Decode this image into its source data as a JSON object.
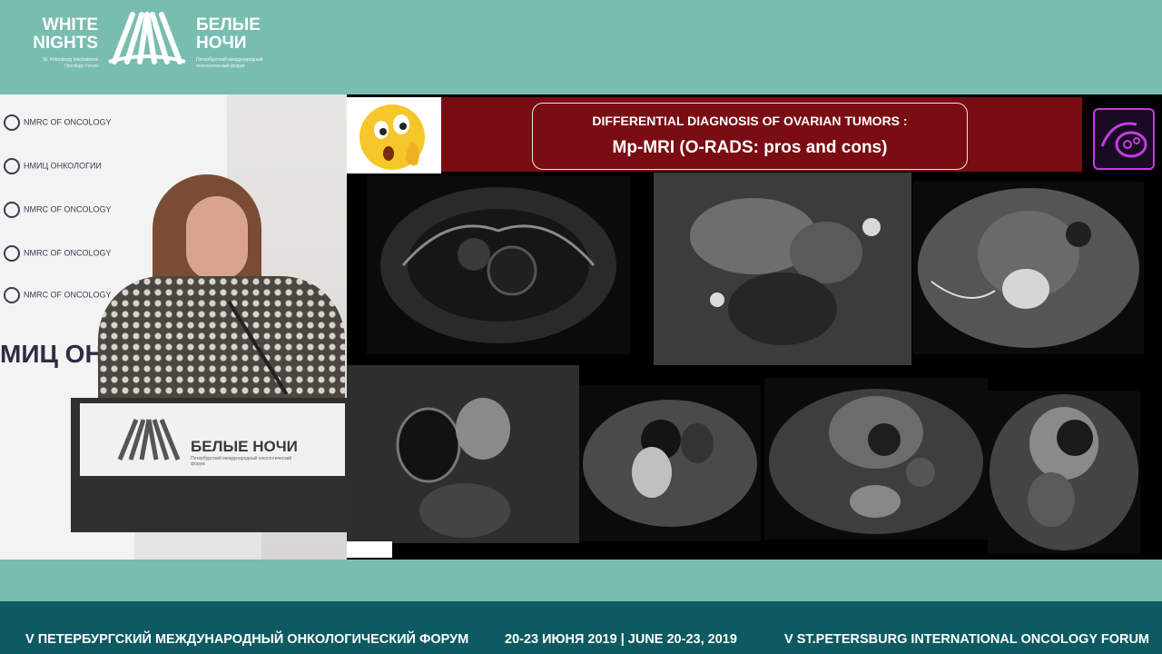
{
  "header": {
    "logo_en_line1": "WHITE",
    "logo_en_line2": "NIGHTS",
    "logo_en_sub": "St. Petersburg International Oncology Forum",
    "logo_ru_line1": "БЕЛЫЕ",
    "logo_ru_line2": "НОЧИ",
    "logo_ru_sub": "Петербургский международный онкологический форум"
  },
  "stage": {
    "banner_rows": [
      "NMRC OF ONCOLOGY",
      "НМИЦ ОНКОЛОГИИ",
      "NMRC OF ONCOLOGY",
      "NMRC OF ONCOLOGY",
      "NMRC OF ONCOLOGY"
    ],
    "banner_big": "МИЦ ОНК",
    "lectern_text": "БЕЛЫЕ НОЧИ",
    "lectern_sub": "Петербургский международный онкологический форум"
  },
  "slide": {
    "title_line1": "DIFFERENTIAL DIAGNOSIS OF OVARIAN TUMORS :",
    "title_line2": "Mp-MRI (O-RADS: pros and cons)"
  },
  "footer": {
    "left": "V ПЕТЕРБУРГСКИЙ МЕЖДУНАРОДНЫЙ ОНКОЛОГИЧЕСКИЙ ФОРУМ",
    "center": "20-23 ИЮНЯ 2019 | JUNE 20-23, 2019",
    "right": "V ST.PETERSBURG INTERNATIONAL ONCOLOGY FORUM"
  },
  "colors": {
    "teal": "#78bdb0",
    "footer_blue": "#0e5a63",
    "slide_red": "#7a0c13"
  }
}
